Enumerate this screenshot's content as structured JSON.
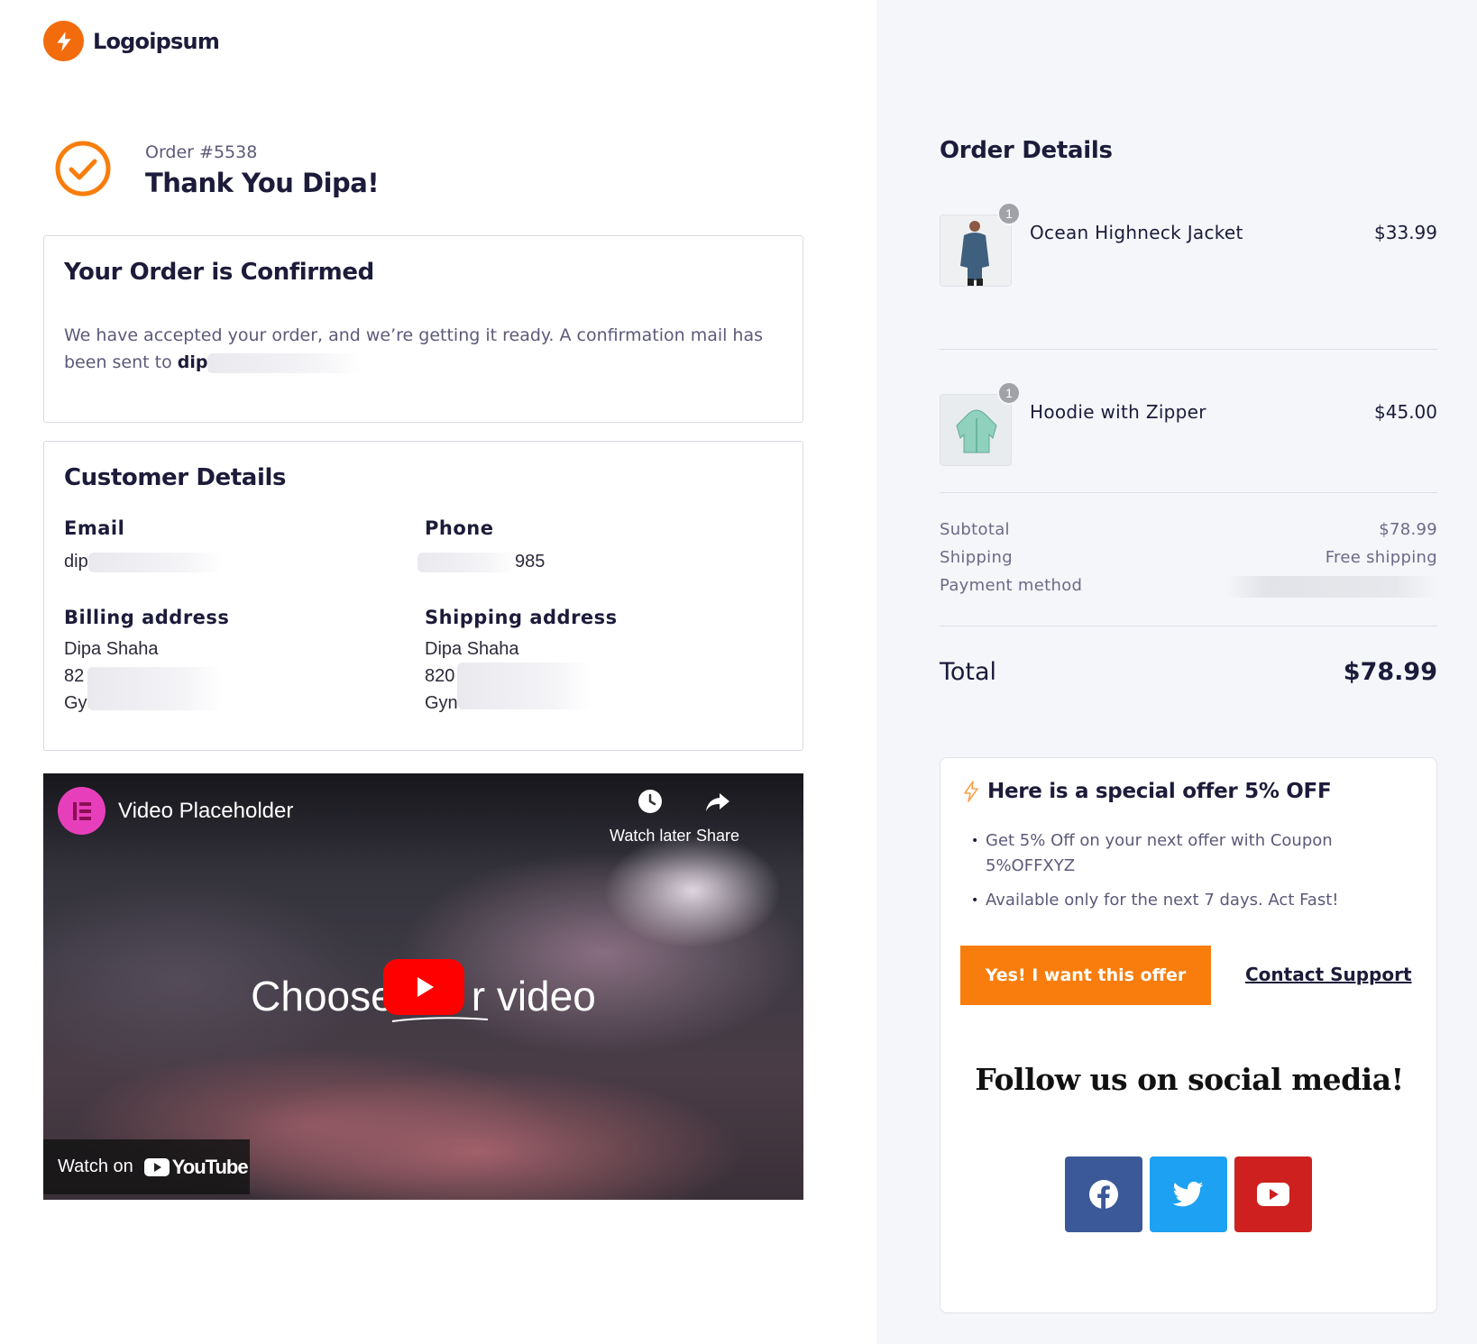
{
  "logo": {
    "text": "Logoipsum"
  },
  "order": {
    "number": "Order #5538",
    "thank_you": "Thank You Dipa!"
  },
  "confirmation": {
    "title": "Your Order is Confirmed",
    "message": "We have accepted your order, and we’re getting it ready. A confirmation mail has been sent to ",
    "email_visible": "dip"
  },
  "customer": {
    "title": "Customer Details",
    "email_label": "Email",
    "email_value": "dip",
    "phone_label": "Phone",
    "phone_value": "985",
    "billing_label": "Billing address",
    "billing": {
      "name": "Dipa Shaha",
      "line1": "82",
      "line2": "Gy"
    },
    "shipping_label": "Shipping address",
    "shipping": {
      "name": "Dipa Shaha",
      "line1": "820",
      "line2": "Gyn"
    }
  },
  "video": {
    "title": "Video Placeholder",
    "watch_later": "Watch later",
    "share": "Share",
    "center_left": "Choose",
    "center_right": "r video",
    "watch_on": "Watch on",
    "youtube": "YouTube"
  },
  "order_details": {
    "title": "Order Details",
    "items": [
      {
        "name": "Ocean Highneck Jacket",
        "price": "$33.99",
        "qty": "1"
      },
      {
        "name": "Hoodie with Zipper",
        "price": "$45.00",
        "qty": "1"
      }
    ],
    "subtotal_label": "Subtotal",
    "subtotal_value": "$78.99",
    "shipping_label": "Shipping",
    "shipping_value": "Free shipping",
    "payment_label": "Payment method",
    "total_label": "Total",
    "total_value": "$78.99"
  },
  "offer": {
    "title": "Here is a special offer 5% OFF",
    "bullets": [
      "Get 5% Off on your next offer with Coupon 5%OFFXYZ",
      "Available only for the next 7 days. Act Fast!"
    ],
    "cta": "Yes! I want this offer",
    "support": "Contact Support",
    "follow": "Follow us on social media!"
  },
  "colors": {
    "accent": "#f97d0c",
    "facebook": "#3b5998",
    "twitter": "#1da1f2",
    "youtube": "#cd201f"
  }
}
